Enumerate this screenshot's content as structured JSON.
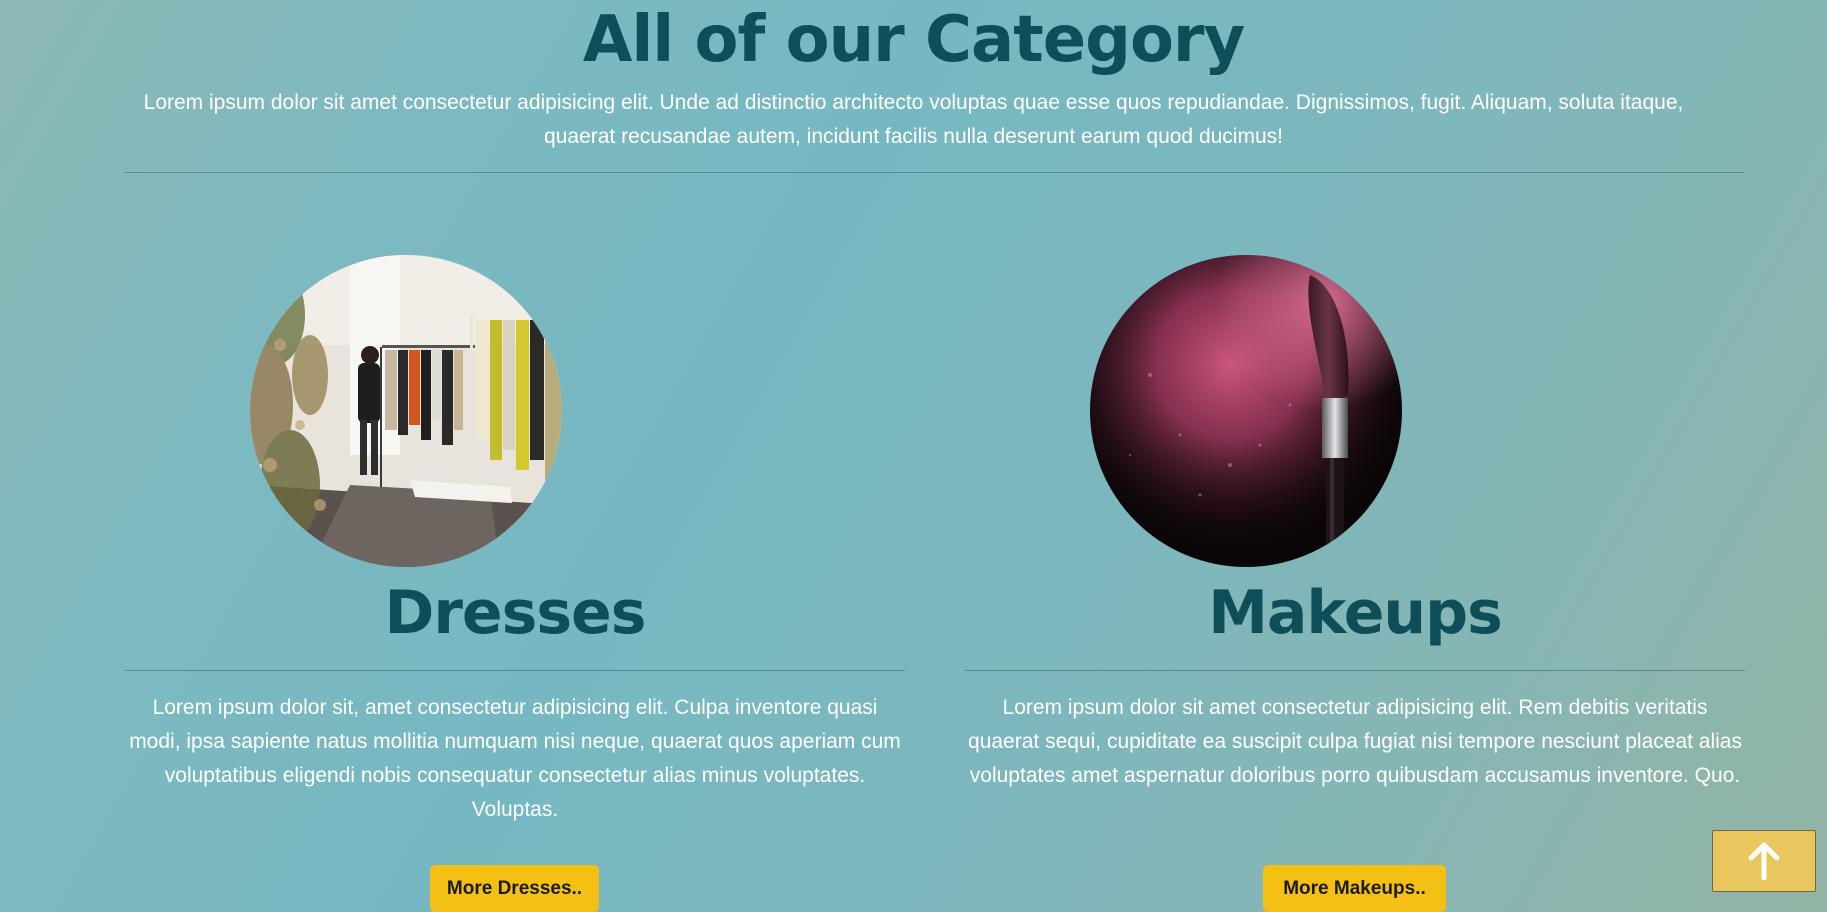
{
  "header": {
    "title": "All of our Category",
    "intro": "Lorem ipsum dolor sit amet consectetur adipisicing elit. Unde ad distinctio architecto voluptas quae esse quos repudiandae. Dignissimos, fugit. Aliquam, soluta itaque, quaerat recusandae autem, incidunt facilis nulla deserunt earum quod ducimus!"
  },
  "categories": [
    {
      "title": "Dresses",
      "image_icon": "clothing-store-photo",
      "text": "Lorem ipsum dolor sit, amet consectetur adipisicing elit. Culpa inventore quasi modi, ipsa sapiente natus mollitia numquam nisi neque, quaerat quos aperiam cum voluptatibus eligendi nobis consequatur consectetur alias minus voluptates. Voluptas.",
      "button_label": "More Dresses.."
    },
    {
      "title": "Makeups",
      "image_icon": "makeup-brush-photo",
      "text": "Lorem ipsum dolor sit amet consectetur adipisicing elit. Rem debitis veritatis quaerat sequi, cupiditate ea suscipit culpa fugiat nisi tempore nesciunt placeat alias voluptates amet aspernatur doloribus porro quibusdam accusamus inventore. Quo.",
      "button_label": "More Makeups.."
    }
  ],
  "scroll_top": {
    "icon": "arrow-up-icon"
  },
  "colors": {
    "heading": "#0d4e58",
    "button": "#f5c014",
    "scroll_button": "#e9c75c"
  }
}
